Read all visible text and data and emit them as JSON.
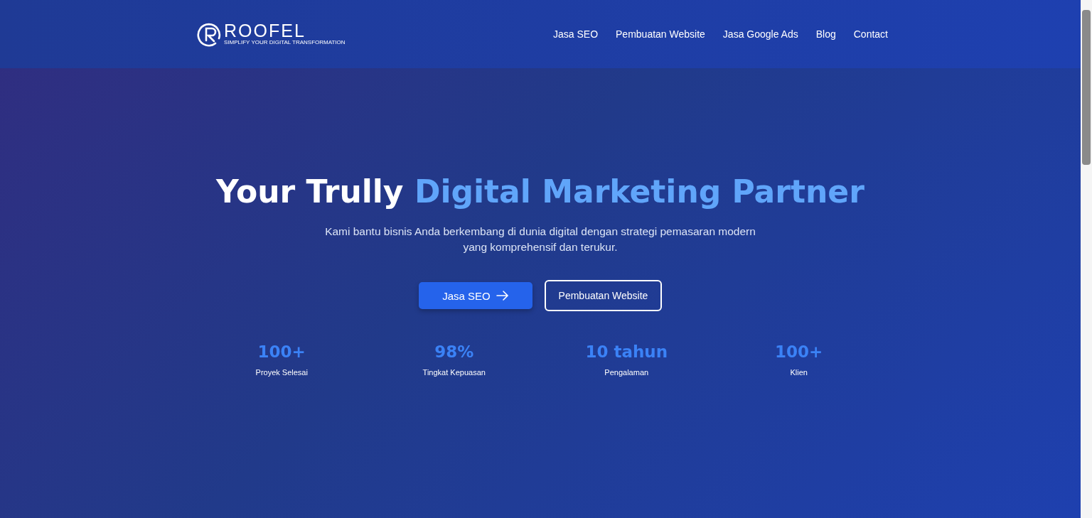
{
  "header": {
    "logo": {
      "name": "ROOFEL",
      "tagline": "SIMPLIFY YOUR DIGITAL TRANSFORMATION"
    },
    "nav": [
      {
        "label": "Jasa SEO"
      },
      {
        "label": "Pembuatan Website"
      },
      {
        "label": "Jasa Google Ads"
      },
      {
        "label": "Blog"
      },
      {
        "label": "Contact"
      }
    ]
  },
  "hero": {
    "title_plain": "Your Trully",
    "title_accent": "Digital Marketing Partner",
    "subtitle": "Kami bantu bisnis Anda berkembang di dunia digital dengan strategi pemasaran modern yang komprehensif dan terukur.",
    "buttons": [
      {
        "label": "Jasa SEO",
        "kind": "primary"
      },
      {
        "label": "Pembuatan Website",
        "kind": "outline"
      }
    ],
    "stats": [
      {
        "value": "100+",
        "label": "Proyek Selesai"
      },
      {
        "value": "98%",
        "label": "Tingkat Kepuasan"
      },
      {
        "value": "10 tahun",
        "label": "Pengalaman"
      },
      {
        "value": "100+",
        "label": "Klien"
      }
    ]
  }
}
